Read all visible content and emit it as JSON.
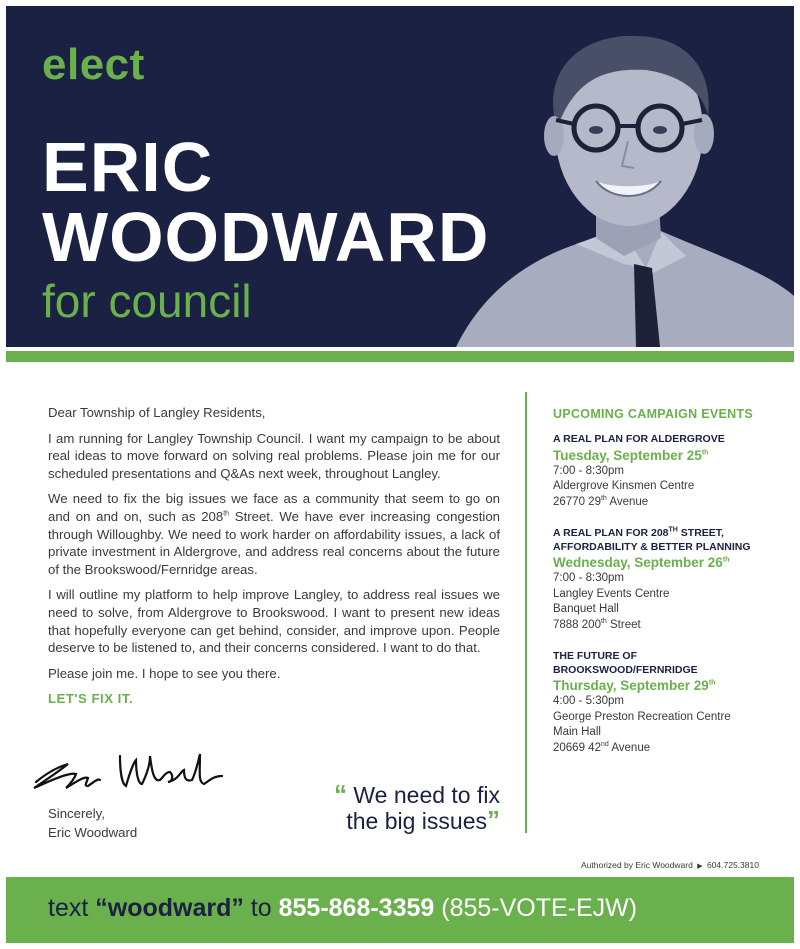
{
  "hero": {
    "elect": "elect",
    "name_line1": "ERIC",
    "name_line2": "WOODWARD",
    "for_council": "for council"
  },
  "letter": {
    "greeting": "Dear Township of Langley Residents,",
    "p1": "I am running for Langley Township Council. I want my campaign to be about real ideas to move forward on solving real problems. Please join me for our scheduled presentations and Q&As next week, throughout Langley.",
    "p2_a": "We need to fix the big issues we face as a community that seem to go on and on and on, such as 208",
    "p2_sup": "th",
    "p2_b": " Street. We have ever increasing congestion through Willoughby. We need to work harder on affordability issues, a lack of private investment in Aldergrove, and address real concerns about the future of the Brookswood/Fernridge areas.",
    "p3": "I will outline my platform to help improve Langley, to address real issues we need to solve, from Aldergrove to Brookswood. I want to present new ideas that hopefully everyone can get behind, consider, and improve upon. People deserve to be listened to, and their concerns considered. I want to do that.",
    "p4": "Please join me. I hope to see you there.",
    "fixit": "LET'S FIX IT.",
    "sincerely": "Sincerely,",
    "signoff": "Eric Woodward"
  },
  "quote": {
    "open": "“",
    "line1": "We need to fix",
    "line2": "the big issues",
    "close": "”"
  },
  "events": {
    "title": "UPCOMING CAMPAIGN EVENTS",
    "items": [
      {
        "head1": "A REAL PLAN FOR ALDERGROVE",
        "date": "Tuesday, September 25",
        "date_sup": "th",
        "time": "7:00 - 8:30pm",
        "venue": "Aldergrove Kinsmen Centre",
        "addr": "26770 29",
        "addr_sup": "th",
        "addr_end": " Avenue"
      },
      {
        "head1a": "A REAL PLAN FOR 208",
        "head1_sup": "TH",
        "head1b": " STREET,",
        "head2": "AFFORDABILITY & BETTER PLANNING",
        "date": "Wednesday, September 26",
        "date_sup": "th",
        "time": "7:00 - 8:30pm",
        "venue": "Langley Events Centre",
        "venue2": "Banquet Hall",
        "addr": "7888 200",
        "addr_sup": "th",
        "addr_end": " Street"
      },
      {
        "head1": "THE FUTURE OF",
        "head2": "BROOKSWOOD/FERNRIDGE",
        "date": "Thursday, September 29",
        "date_sup": "th",
        "time": "4:00 - 5:30pm",
        "venue": "George Preston Recreation Centre",
        "venue2": "Main Hall",
        "addr": "20669 42",
        "addr_sup": "nd",
        "addr_end": " Avenue"
      }
    ]
  },
  "auth": {
    "by": "Authorized by Eric Woodward",
    "phone": "604.725.3810"
  },
  "footer": {
    "text": "text ",
    "keyword": "“woodward”",
    "to": " to ",
    "phone": "855-868-3359",
    "alt": " (855-VOTE-EJW)"
  },
  "colors": {
    "navy": "#1b2142",
    "green": "#6ab04c"
  }
}
